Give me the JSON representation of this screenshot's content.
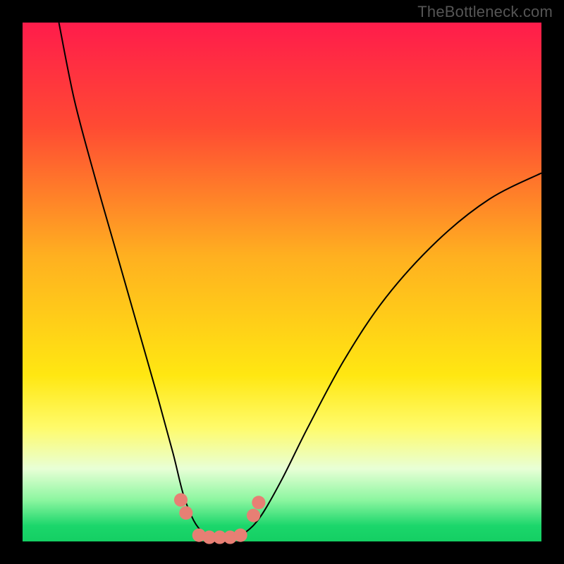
{
  "watermark": "TheBottleneck.com",
  "chart_data": {
    "type": "line",
    "title": "",
    "xlabel": "",
    "ylabel": "",
    "xlim": [
      0,
      100
    ],
    "ylim": [
      0,
      100
    ],
    "background_gradient_stops": [
      {
        "offset": 0,
        "color": "#ff1c4b"
      },
      {
        "offset": 20,
        "color": "#ff4a33"
      },
      {
        "offset": 45,
        "color": "#ffb020"
      },
      {
        "offset": 68,
        "color": "#ffe712"
      },
      {
        "offset": 78,
        "color": "#fffb6a"
      },
      {
        "offset": 86,
        "color": "#e8ffd6"
      },
      {
        "offset": 92,
        "color": "#8cf6a0"
      },
      {
        "offset": 97,
        "color": "#1bd66b"
      },
      {
        "offset": 100,
        "color": "#14cf63"
      }
    ],
    "series": [
      {
        "name": "bottleneck-curve",
        "stroke": "#000000",
        "points": [
          {
            "x": 7.0,
            "y": 100.0
          },
          {
            "x": 10.0,
            "y": 85.0
          },
          {
            "x": 14.0,
            "y": 70.0
          },
          {
            "x": 18.0,
            "y": 56.0
          },
          {
            "x": 22.0,
            "y": 42.0
          },
          {
            "x": 26.0,
            "y": 28.0
          },
          {
            "x": 29.0,
            "y": 17.0
          },
          {
            "x": 31.0,
            "y": 9.0
          },
          {
            "x": 33.0,
            "y": 4.0
          },
          {
            "x": 35.0,
            "y": 1.5
          },
          {
            "x": 37.0,
            "y": 0.7
          },
          {
            "x": 40.0,
            "y": 0.7
          },
          {
            "x": 43.0,
            "y": 1.8
          },
          {
            "x": 46.0,
            "y": 5.0
          },
          {
            "x": 50.0,
            "y": 12.0
          },
          {
            "x": 55.0,
            "y": 22.0
          },
          {
            "x": 62.0,
            "y": 35.0
          },
          {
            "x": 70.0,
            "y": 47.0
          },
          {
            "x": 80.0,
            "y": 58.0
          },
          {
            "x": 90.0,
            "y": 66.0
          },
          {
            "x": 100.0,
            "y": 71.0
          }
        ]
      },
      {
        "name": "data-markers",
        "stroke": "#e77f74",
        "marker": "circle",
        "marker_radius": 1.3,
        "points": [
          {
            "x": 30.5,
            "y": 8.0
          },
          {
            "x": 31.5,
            "y": 5.5
          },
          {
            "x": 34.0,
            "y": 1.2
          },
          {
            "x": 36.0,
            "y": 0.8
          },
          {
            "x": 38.0,
            "y": 0.8
          },
          {
            "x": 40.0,
            "y": 0.8
          },
          {
            "x": 42.0,
            "y": 1.2
          },
          {
            "x": 44.5,
            "y": 5.0
          },
          {
            "x": 45.5,
            "y": 7.5
          }
        ]
      }
    ]
  }
}
